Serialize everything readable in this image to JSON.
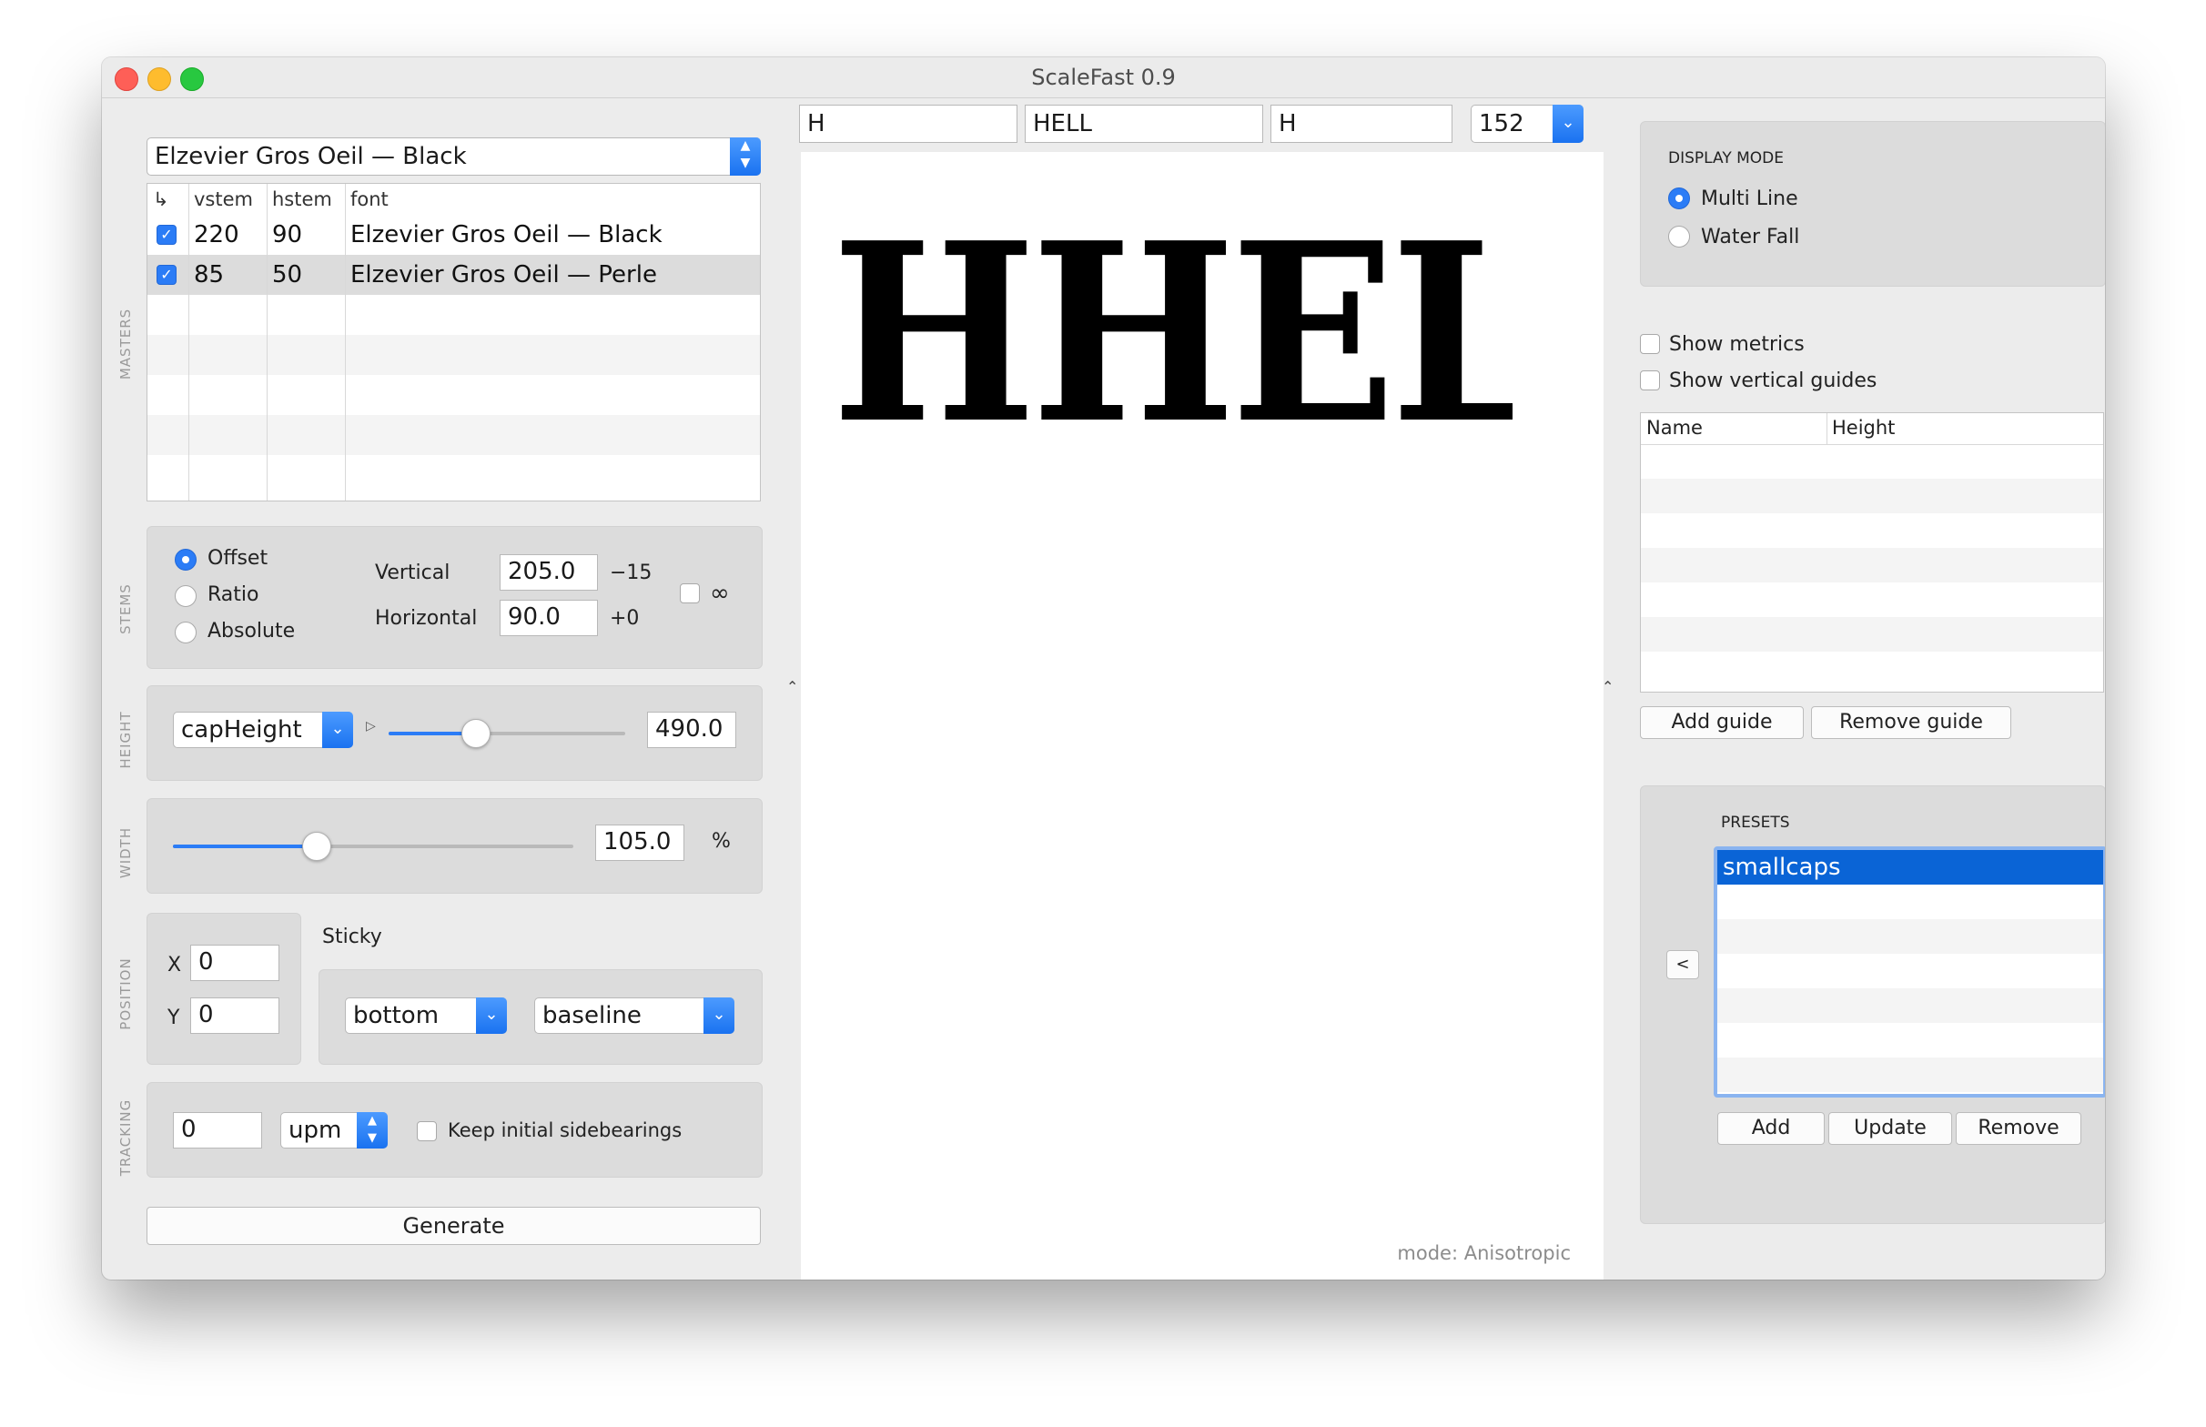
{
  "window": {
    "title": "ScaleFast 0.9"
  },
  "top_fields": {
    "field1": "H",
    "field2": "HELL",
    "field3": "H",
    "size": "152"
  },
  "left": {
    "font_select": "Elzevier Gros Oeil — Black",
    "masters_label": "MASTERS",
    "masters_table": {
      "headers": [
        "↳",
        "vstem",
        "hstem",
        "font"
      ],
      "rows": [
        {
          "checked": true,
          "vstem": "220",
          "hstem": "90",
          "font": "Elzevier Gros Oeil — Black"
        },
        {
          "checked": true,
          "vstem": "85",
          "hstem": "50",
          "font": "Elzevier Gros Oeil — Perle"
        }
      ]
    },
    "stems": {
      "label": "STEMS",
      "modes": [
        "Offset",
        "Ratio",
        "Absolute"
      ],
      "selected": "Offset",
      "vertical_label": "Vertical",
      "vertical_value": "205.0",
      "vertical_delta": "−15",
      "horizontal_label": "Horizontal",
      "horizontal_value": "90.0",
      "horizontal_delta": "+0",
      "infinity_symbol": "∞",
      "infinity_checked": false
    },
    "height": {
      "label": "HEIGHT",
      "reference": "capHeight",
      "slider_fraction": 0.37,
      "value": "490.0"
    },
    "width": {
      "label": "WIDTH",
      "slider_fraction": 0.36,
      "value": "105.0",
      "unit": "%"
    },
    "position": {
      "label": "POSITION",
      "x_label": "X",
      "x_value": "0",
      "y_label": "Y",
      "y_value": "0",
      "sticky_label": "Sticky",
      "sticky_vertical": "bottom",
      "sticky_reference": "baseline"
    },
    "tracking": {
      "label": "TRACKING",
      "value": "0",
      "unit": "upm",
      "keep_sidebearings_label": "Keep initial sidebearings",
      "keep_sidebearings_checked": false
    },
    "generate_label": "Generate"
  },
  "preview": {
    "text": "HHEL",
    "mode": "mode: Anisotropic"
  },
  "right": {
    "display_mode": {
      "label": "DISPLAY MODE",
      "options": [
        "Multi Line",
        "Water Fall"
      ],
      "selected": "Multi Line"
    },
    "show_metrics_label": "Show metrics",
    "show_vertical_guides_label": "Show vertical guides",
    "guides_table": {
      "headers": [
        "Name",
        "Height"
      ]
    },
    "add_guide_label": "Add guide",
    "remove_guide_label": "Remove guide",
    "presets": {
      "label": "PRESETS",
      "items": [
        "smallcaps"
      ],
      "selected": "smallcaps",
      "collapse_label": "<",
      "add_label": "Add",
      "update_label": "Update",
      "remove_label": "Remove"
    }
  },
  "colors": {
    "accent": "#2b7cf6",
    "selection": "#0a64d6"
  }
}
